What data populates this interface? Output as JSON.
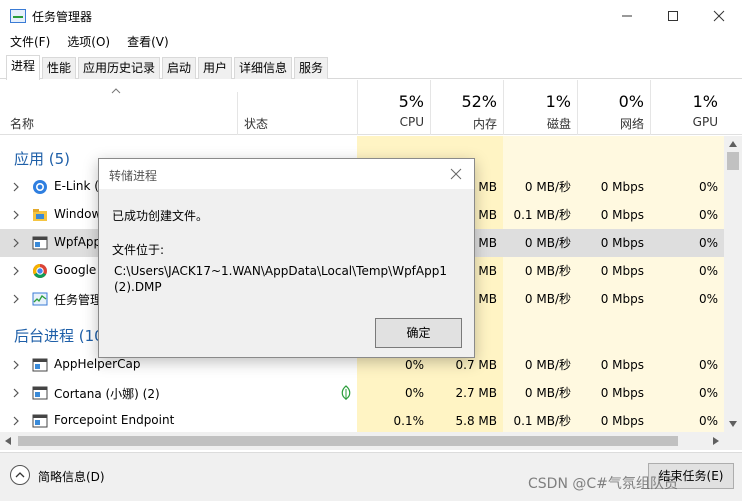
{
  "window": {
    "title": "任务管理器"
  },
  "menu": [
    "文件(F)",
    "选项(O)",
    "查看(V)"
  ],
  "tabs": [
    "进程",
    "性能",
    "应用历史记录",
    "启动",
    "用户",
    "详细信息",
    "服务"
  ],
  "header": {
    "name": "名称",
    "status": "状态",
    "metrics": [
      {
        "pct": "5%",
        "label": "CPU"
      },
      {
        "pct": "52%",
        "label": "内存"
      },
      {
        "pct": "1%",
        "label": "磁盘"
      },
      {
        "pct": "0%",
        "label": "网络"
      },
      {
        "pct": "1%",
        "label": "GPU"
      }
    ]
  },
  "groups": {
    "apps": "应用 (5)",
    "background": "后台进程 (10)"
  },
  "rows": [
    {
      "name": "E-Link (",
      "icon": "elink-icon",
      "cpu": "",
      "mem": "MB",
      "disk": "0 MB/秒",
      "net": "0 Mbps",
      "gpu": "0%"
    },
    {
      "name": "Window",
      "icon": "folder-icon",
      "cpu": "",
      "mem": "MB",
      "disk": "0.1 MB/秒",
      "net": "0 Mbps",
      "gpu": "0%"
    },
    {
      "name": "WpfApp",
      "icon": "app-window-icon",
      "cpu": "",
      "mem": "MB",
      "disk": "0 MB/秒",
      "net": "0 Mbps",
      "gpu": "0%"
    },
    {
      "name": "Google",
      "icon": "chrome-icon",
      "cpu": "",
      "mem": "MB",
      "disk": "0 MB/秒",
      "net": "0 Mbps",
      "gpu": "0%"
    },
    {
      "name": "任务管理",
      "icon": "task-manager-icon",
      "cpu": "",
      "mem": "MB",
      "disk": "0 MB/秒",
      "net": "0 Mbps",
      "gpu": "0%"
    },
    {
      "name": "AppHelperCap",
      "icon": "app-window-icon",
      "cpu": "0%",
      "mem": "0.7 MB",
      "disk": "0 MB/秒",
      "net": "0 Mbps",
      "gpu": "0%"
    },
    {
      "name": "Cortana (小娜) (2)",
      "icon": "app-window-icon",
      "cpu": "0%",
      "mem": "2.7 MB",
      "disk": "0 MB/秒",
      "net": "0 Mbps",
      "gpu": "0%"
    },
    {
      "name": "Forcepoint Endpoint",
      "icon": "app-window-icon",
      "cpu": "0.1%",
      "mem": "5.8 MB",
      "disk": "0.1 MB/秒",
      "net": "0 Mbps",
      "gpu": "0%"
    }
  ],
  "footer": {
    "less_details": "简略信息(D)",
    "end_task": "结束任务(E)",
    "watermark": "CSDN @C#气氛组队员"
  },
  "dialog": {
    "title": "转储进程",
    "message": "已成功创建文件。",
    "location_label": "文件位于:",
    "path": "C:\\Users\\JACK17~1.WAN\\AppData\\Local\\Temp\\WpfApp1 (2).DMP",
    "ok": "确定"
  },
  "colors": {
    "group_title": "#1e5fa8",
    "metric_bg": "#fff4c4",
    "metric_bg_light": "#fff9e0",
    "selected_row": "#dedede"
  }
}
